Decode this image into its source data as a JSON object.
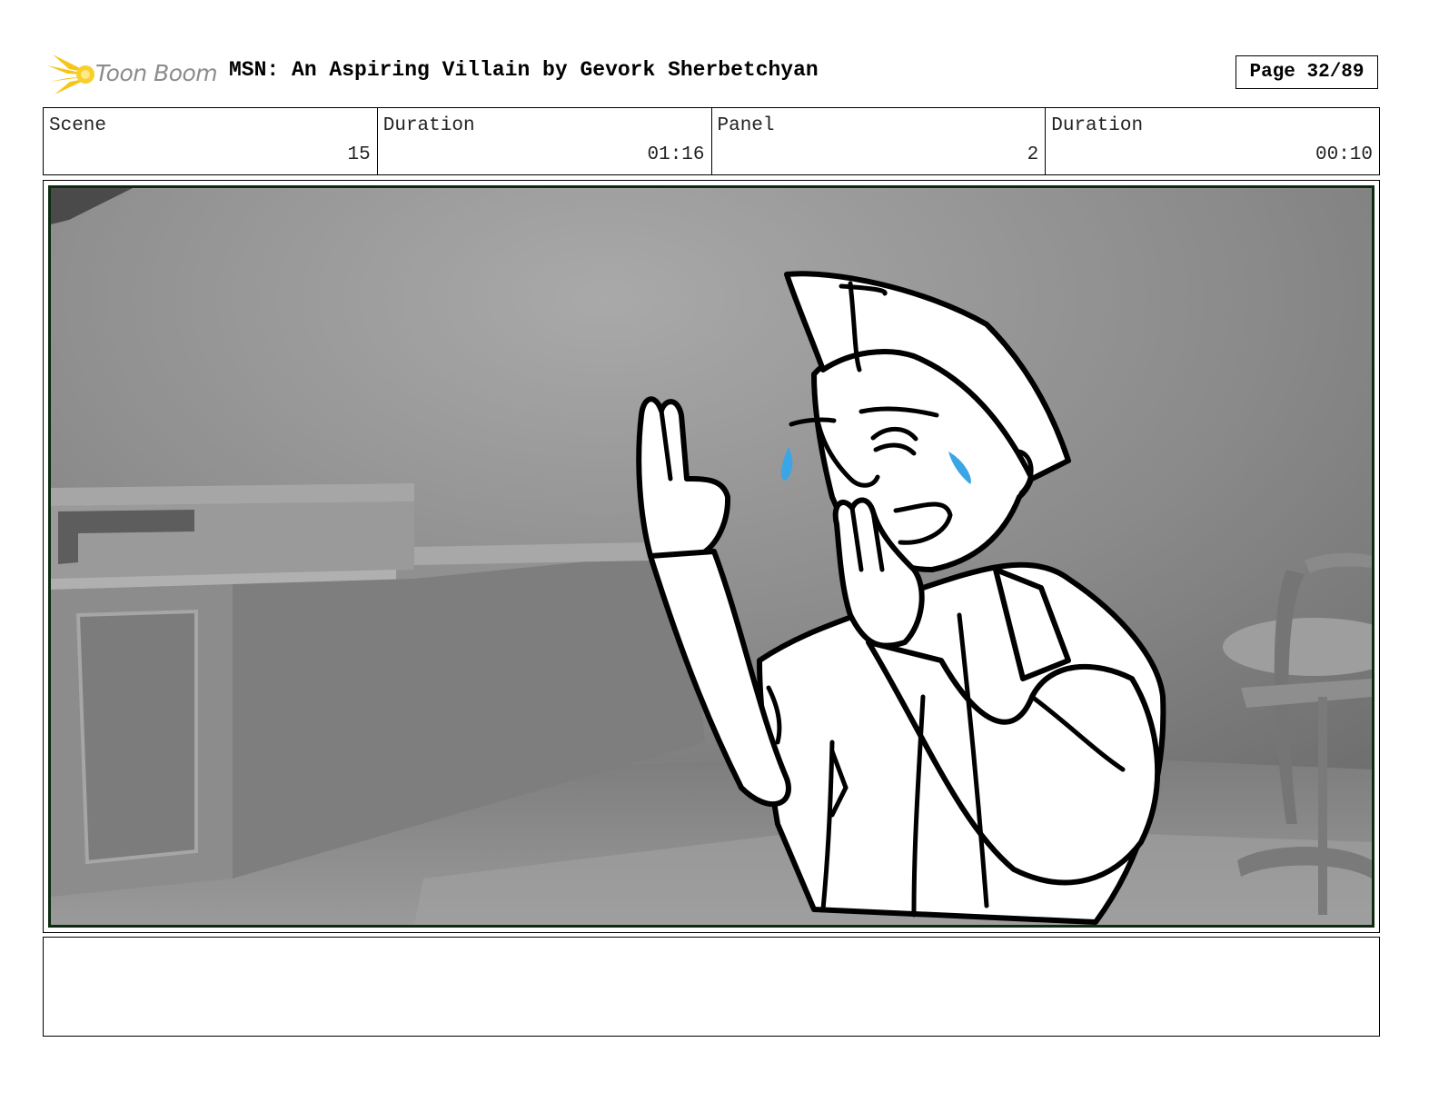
{
  "header": {
    "logo_text": "Toon Boom",
    "title": "MSN: An Aspiring Villain by Gevork Sherbetchyan",
    "page_label": "Page 32/89"
  },
  "info": {
    "scene_label": "Scene",
    "scene_value": "15",
    "scene_duration_label": "Duration",
    "scene_duration_value": "01:16",
    "panel_label": "Panel",
    "panel_value": "2",
    "panel_duration_label": "Duration",
    "panel_duration_value": "00:10"
  },
  "panel": {
    "image_icon": "storyboard-sketch",
    "tear_color": "#3ba6e6"
  },
  "notes": {
    "text": ""
  }
}
